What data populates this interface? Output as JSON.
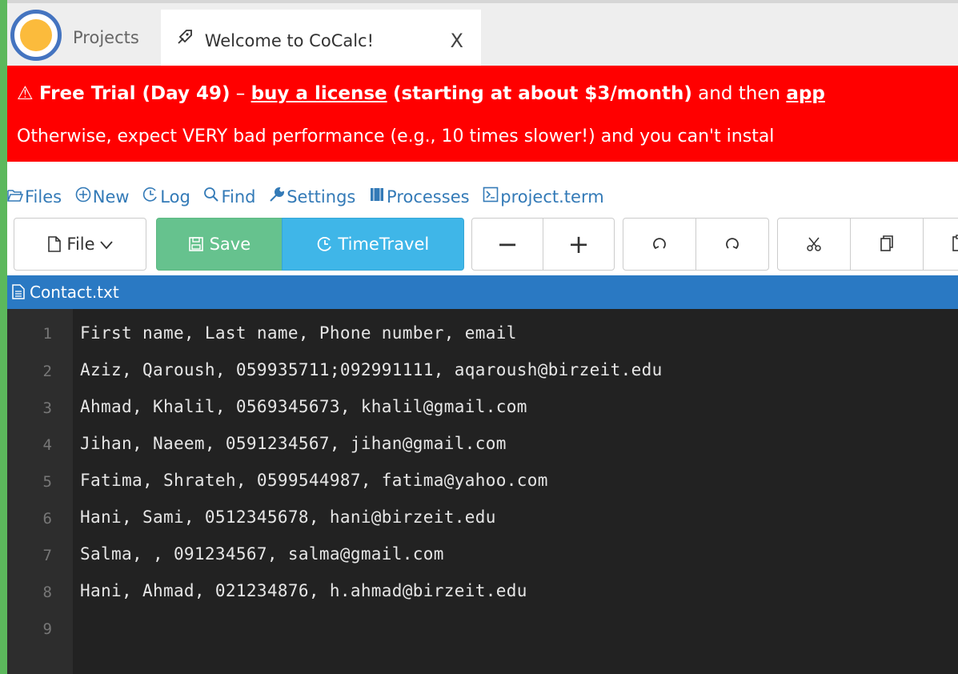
{
  "tabs": {
    "projects_label": "Projects",
    "active_label": "Welcome to CoCalc!",
    "close_glyph": "X"
  },
  "banner": {
    "warn_glyph": "⚠",
    "trial": "Free Trial (Day 49)",
    "dash": " – ",
    "link": "buy a license",
    "pricing": "(starting at about $3/month)",
    "tail": " and then ",
    "tail_link": "app",
    "line2": "Otherwise, expect VERY bad performance (e.g., 10 times slower!) and you can't instal"
  },
  "nav": {
    "files": "Files",
    "new": "New",
    "log": "Log",
    "find": "Find",
    "settings": "Settings",
    "processes": "Processes",
    "term": "project.term"
  },
  "toolbar": {
    "file": "File",
    "save": "Save",
    "timetravel": "TimeTravel",
    "minus": "−",
    "plus": "+"
  },
  "file_title": "Contact.txt",
  "editor": {
    "line_numbers": [
      "1",
      "2",
      "3",
      "4",
      "5",
      "6",
      "7",
      "8",
      "9"
    ],
    "lines": [
      "First name, Last name, Phone number, email",
      "Aziz, Qaroush, 059935711;092991111, aqaroush@birzeit.edu",
      "Ahmad, Khalil, 0569345673, khalil@gmail.com",
      "Jihan, Naeem, 0591234567, jihan@gmail.com",
      "Fatima, Shrateh, 0599544987, fatima@yahoo.com",
      "Hani, Sami, 0512345678, hani@birzeit.edu",
      "Salma, , 091234567, salma@gmail.com",
      "Hani, Ahmad, 021234876, h.ahmad@birzeit.edu",
      ""
    ]
  },
  "colors": {
    "banner_bg": "#ff0000",
    "save_bg": "#66c28e",
    "timetravel_bg": "#3fb6e8",
    "file_bar_bg": "#2a79c3",
    "editor_bg": "#222222",
    "left_bar": "#5cb85c"
  }
}
